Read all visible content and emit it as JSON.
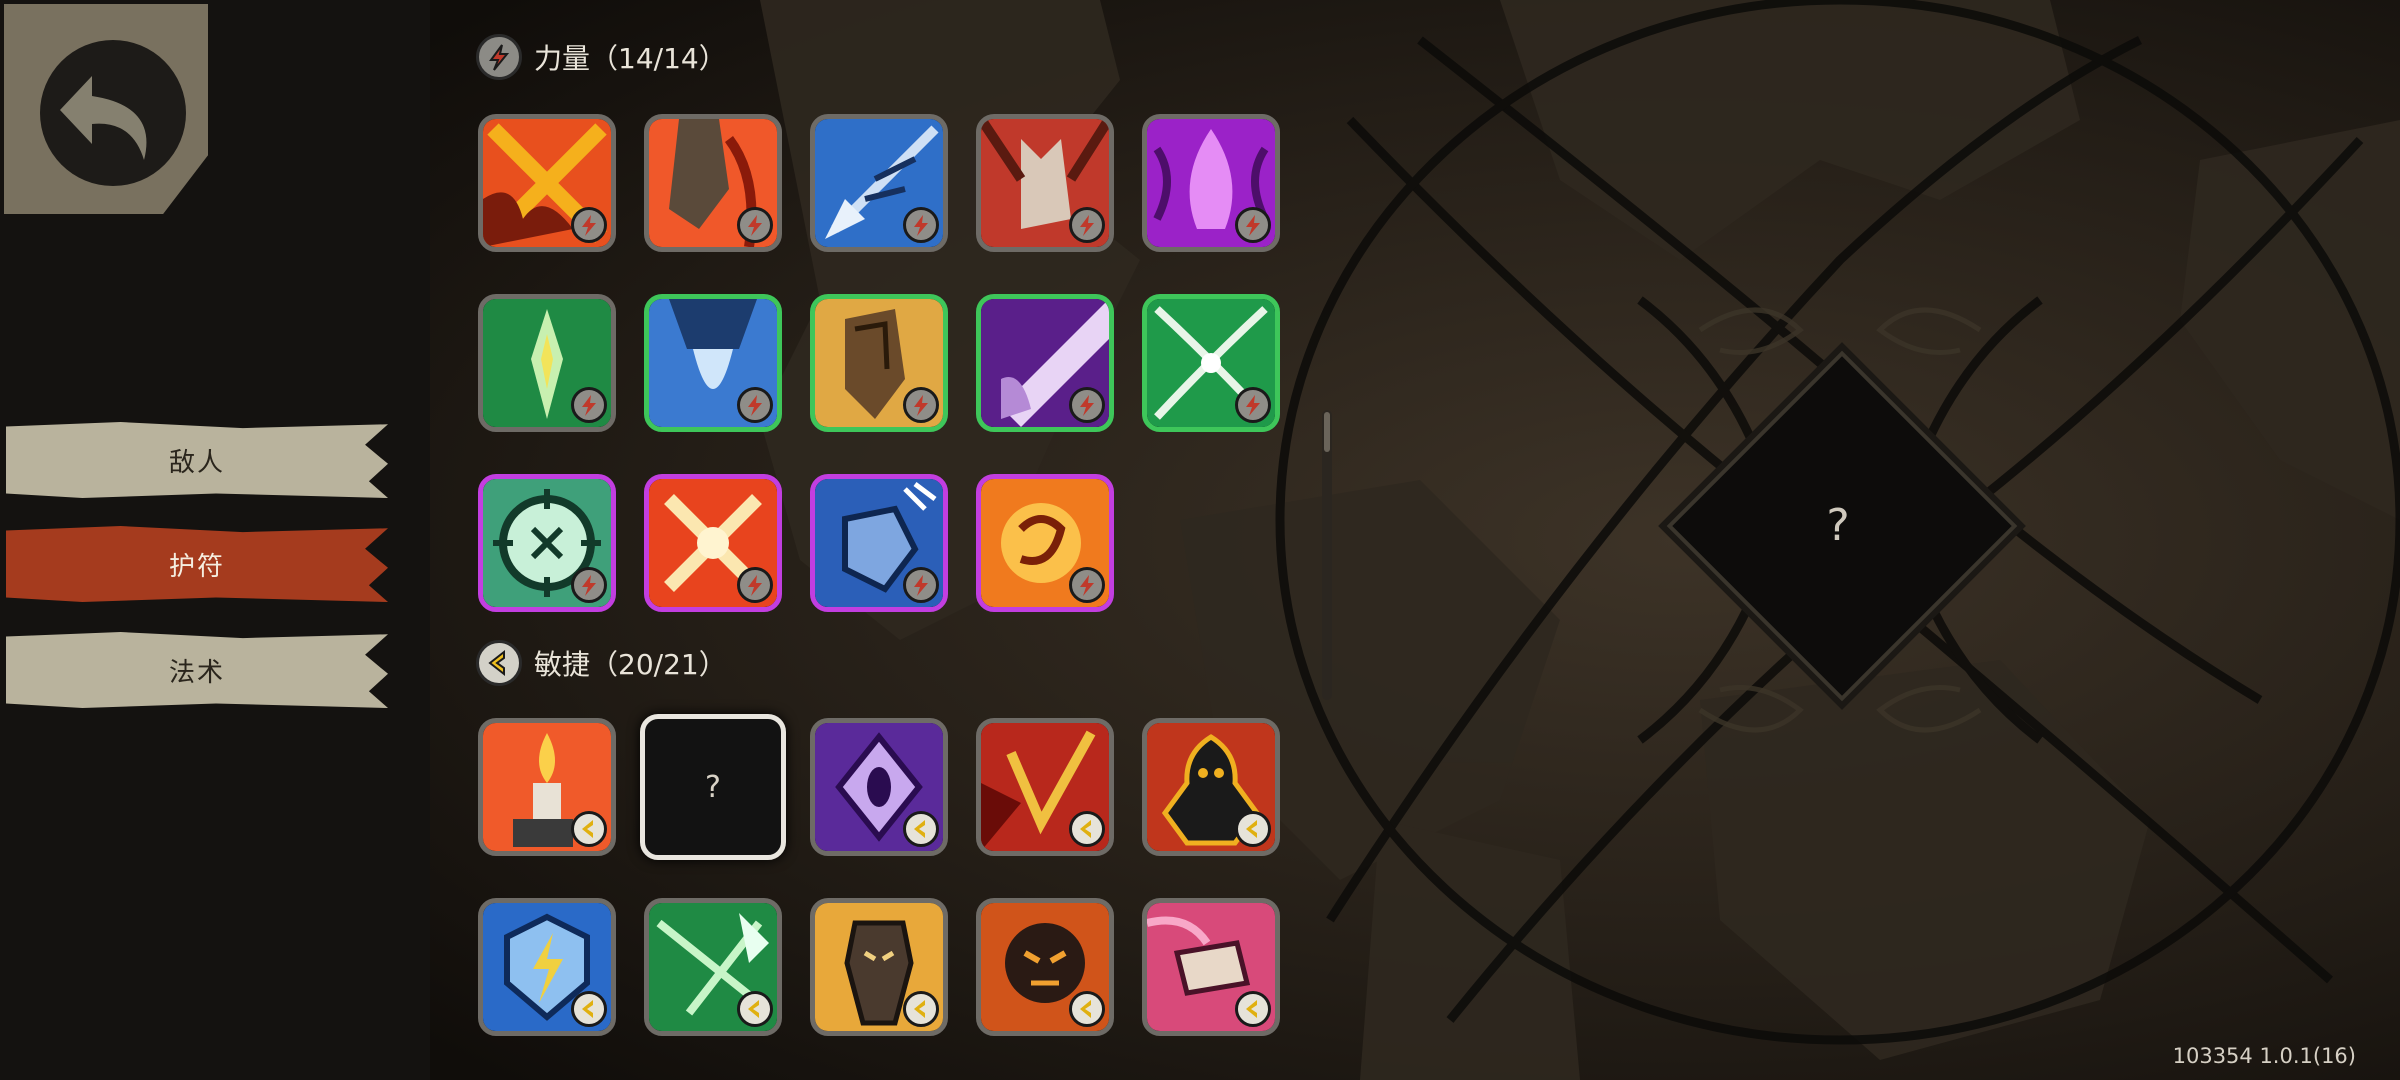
{
  "nav": {
    "back_button": "back",
    "tabs": [
      {
        "label": "敌人",
        "active": false
      },
      {
        "label": "护符",
        "active": true
      },
      {
        "label": "法术",
        "active": false
      }
    ]
  },
  "sections": [
    {
      "label": "力量（14/14）",
      "icon": "strength-icon"
    },
    {
      "label": "敏捷（20/21）",
      "icon": "agility-icon"
    }
  ],
  "unknown_card_label": "?",
  "detail_panel": {
    "placeholder": "?"
  },
  "version": "103354 1.0.1(16)",
  "colors": {
    "tab_active": "#a53b1e",
    "tab_inactive": "#b9b39d",
    "border_green": "#3ec65a",
    "border_purple": "#c23ee0",
    "border_gray": "#6e6b66"
  }
}
